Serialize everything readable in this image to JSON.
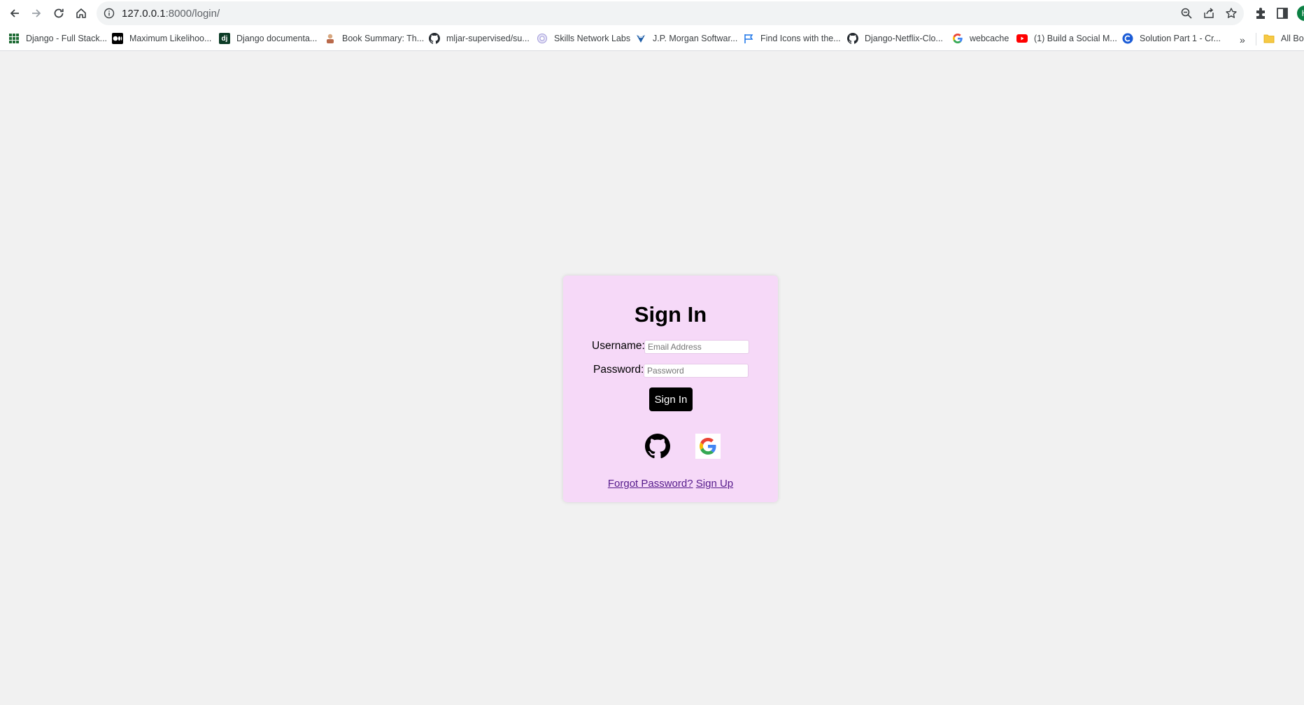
{
  "browser": {
    "url_host": "127.0.0.1",
    "url_path": ":8000/login/",
    "profile_initial": "H",
    "bookmarks": [
      {
        "label": "Django - Full Stack...",
        "icon": "grid-icon"
      },
      {
        "label": "Maximum Likelihoo...",
        "icon": "medium-icon"
      },
      {
        "label": "Django documenta...",
        "icon": "django-icon"
      },
      {
        "label": "Book Summary: Th...",
        "icon": "book-icon"
      },
      {
        "label": "mljar-supervised/su...",
        "icon": "github-icon"
      },
      {
        "label": "Skills Network Labs",
        "icon": "skills-icon"
      },
      {
        "label": "J.P. Morgan Softwar...",
        "icon": "jpm-icon"
      },
      {
        "label": "Find Icons with the...",
        "icon": "flag-icon"
      },
      {
        "label": "Django-Netflix-Clo...",
        "icon": "github-icon"
      },
      {
        "label": "webcache",
        "icon": "google-icon"
      },
      {
        "label": "(1) Build a Social M...",
        "icon": "youtube-icon"
      },
      {
        "label": "Solution Part 1 - Cr...",
        "icon": "c-icon"
      }
    ],
    "bookmarks_more": "»",
    "all_bookmarks_label": "All Boo"
  },
  "login": {
    "title": "Sign In",
    "username_label": "Username:",
    "username_placeholder": "Email Address",
    "password_label": "Password:",
    "password_placeholder": "Password",
    "submit_label": "Sign In",
    "social": [
      "github-icon",
      "google-icon"
    ],
    "forgot_label": "Forgot Password?",
    "signup_label": "Sign Up"
  },
  "colors": {
    "page_bg": "#f1f1f1",
    "card_bg": "#f6d9f8",
    "button_bg": "#000000",
    "link": "#551a8b"
  }
}
